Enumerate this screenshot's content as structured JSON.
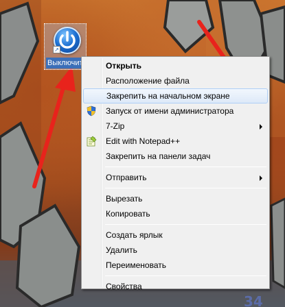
{
  "desktop": {
    "shortcut_label": "Выключить",
    "bottom_corner_text": "34"
  },
  "context_menu": {
    "items": [
      {
        "label": "Открыть",
        "bold": true
      },
      {
        "label": "Расположение файла"
      },
      {
        "label": "Закрепить на начальном экране",
        "highlighted": true
      },
      {
        "label": "Запуск от имени администратора",
        "icon": "uac-shield-icon"
      },
      {
        "label": "7-Zip",
        "submenu": true
      },
      {
        "label": "Edit with Notepad++",
        "icon": "notepadpp-icon"
      },
      {
        "label": "Закрепить на панели задач"
      },
      {
        "label": "Отправить",
        "submenu": true
      },
      {
        "label": "Вырезать"
      },
      {
        "label": "Копировать"
      },
      {
        "label": "Создать ярлык"
      },
      {
        "label": "Удалить"
      },
      {
        "label": "Переименовать"
      },
      {
        "label": "Свойства"
      }
    ]
  },
  "colors": {
    "arrow": "#e8231c",
    "highlight_border": "#aecff7",
    "menu_bg": "#f0f0f0",
    "label_bg": "#3c6fb8"
  }
}
